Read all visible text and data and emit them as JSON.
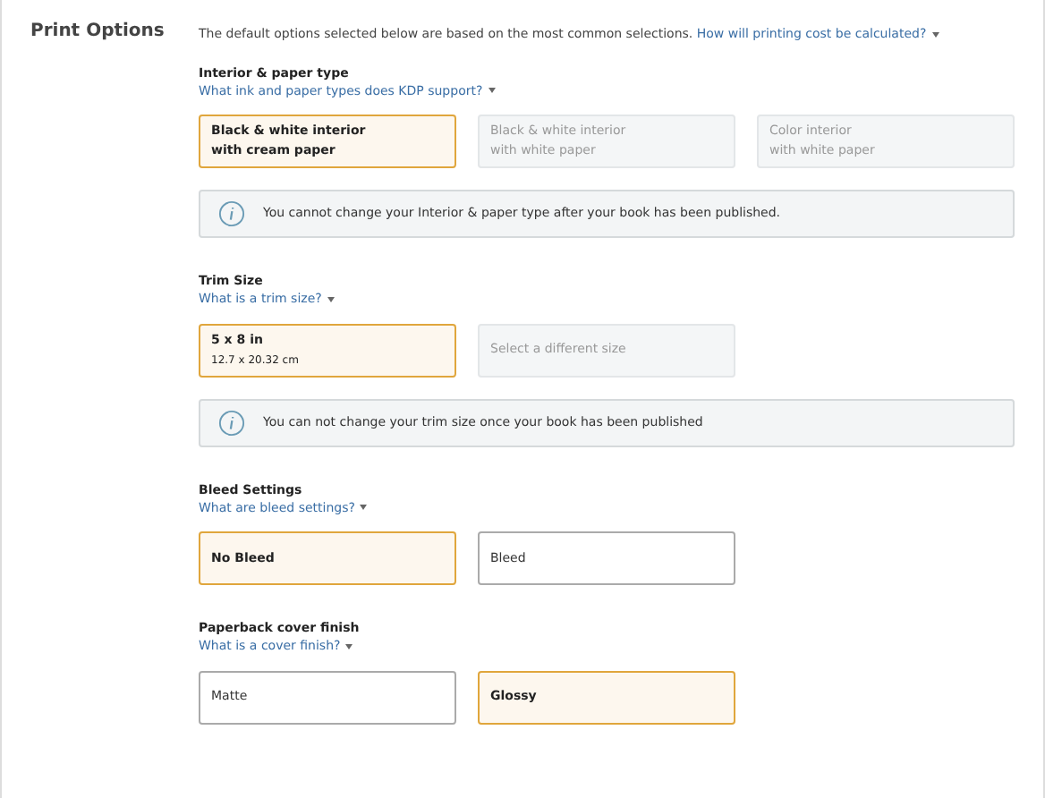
{
  "section_title": "Print Options",
  "intro": {
    "text": "The default options selected below are based on the most common selections.",
    "link": "How will printing cost be calculated?"
  },
  "groups": [
    {
      "heading": "Interior & paper type",
      "help_link": "What ink and paper types does KDP support?",
      "options": [
        {
          "lines": [
            "Black & white interior",
            "with cream paper"
          ],
          "selected": true,
          "disabled": false
        },
        {
          "lines": [
            "Black & white interior",
            "with white paper"
          ],
          "selected": false,
          "disabled": true
        },
        {
          "lines": [
            "Color interior",
            "with white paper"
          ],
          "selected": false,
          "disabled": true
        }
      ],
      "notice": "You cannot change your Interior & paper type after your book has been published."
    },
    {
      "heading": "Trim Size",
      "help_link": "What is a trim size?",
      "options": [
        {
          "lines": [
            "5 x 8 in",
            "12.7 x 20.32 cm"
          ],
          "selected": true,
          "disabled": false
        },
        {
          "lines": [
            "Select a different size"
          ],
          "selected": false,
          "disabled": true
        }
      ],
      "notice": "You can not change your trim size once your book has been published"
    },
    {
      "heading": "Bleed Settings",
      "help_link": "What are bleed settings?",
      "options": [
        {
          "lines": [
            "No Bleed"
          ],
          "selected": true,
          "disabled": false
        },
        {
          "lines": [
            "Bleed"
          ],
          "selected": false,
          "disabled": false
        }
      ]
    },
    {
      "heading": "Paperback cover finish",
      "help_link": "What is a cover finish?",
      "options": [
        {
          "lines": [
            "Matte"
          ],
          "selected": false,
          "disabled": false
        },
        {
          "lines": [
            "Glossy"
          ],
          "selected": true,
          "disabled": false
        }
      ]
    }
  ]
}
